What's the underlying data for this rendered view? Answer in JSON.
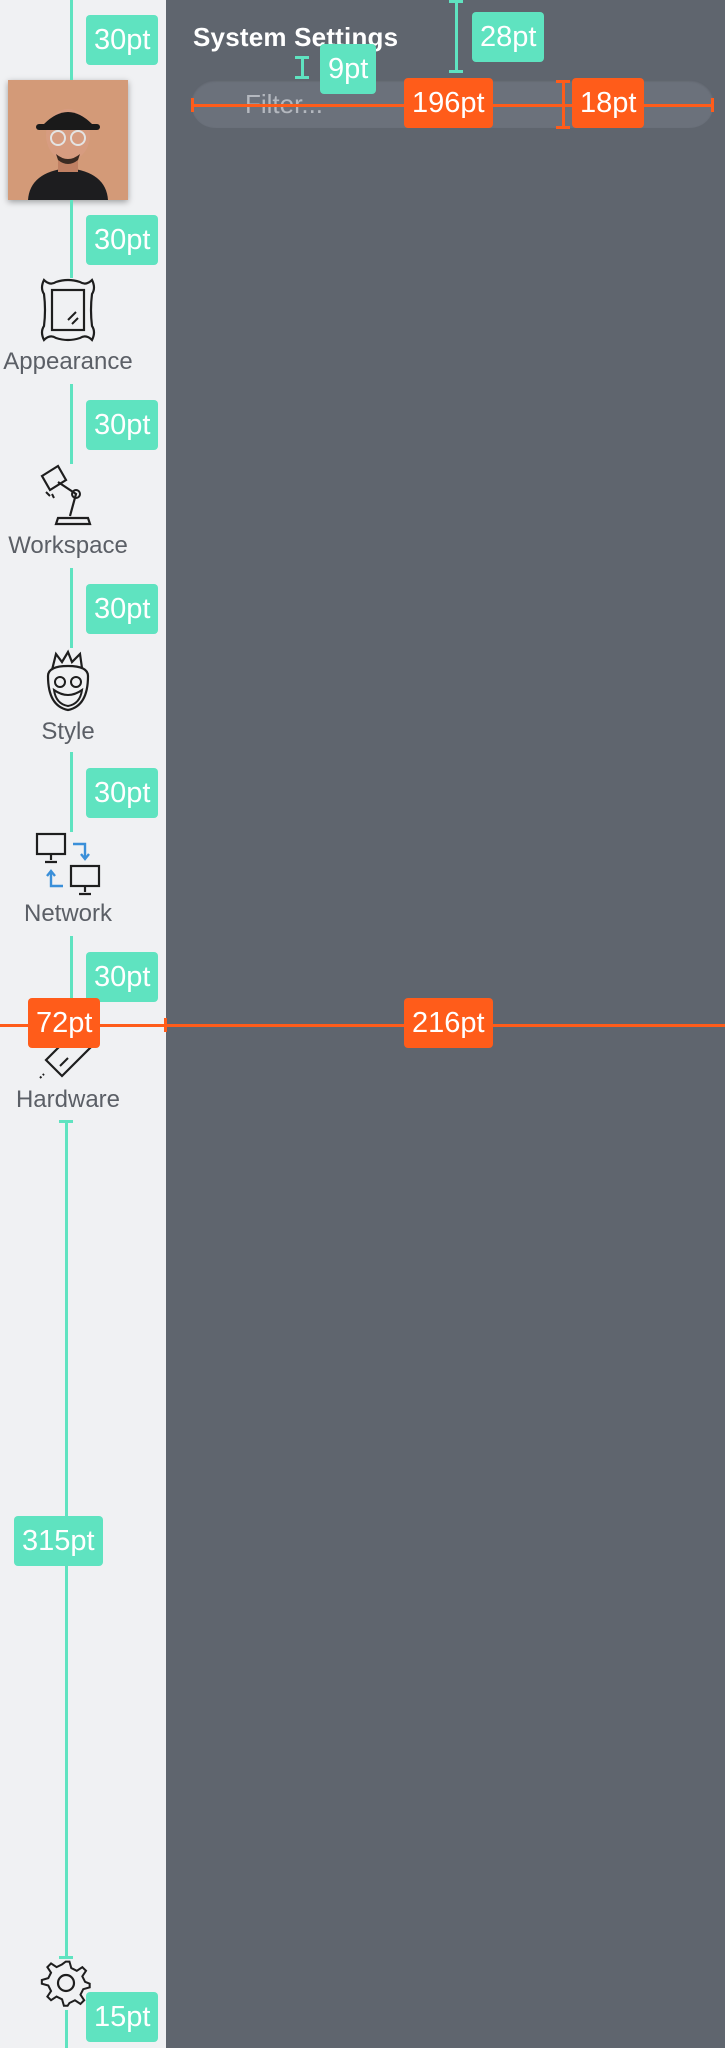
{
  "header": {
    "title": "System Settings"
  },
  "filter": {
    "placeholder": "Filter..."
  },
  "sidebar": {
    "items": [
      {
        "label": "Appearance",
        "icon": "picture-frame-icon"
      },
      {
        "label": "Workspace",
        "icon": "desk-lamp-icon"
      },
      {
        "label": "Style",
        "icon": "bearded-face-icon"
      },
      {
        "label": "Network",
        "icon": "network-computers-icon"
      },
      {
        "label": "Hardware",
        "icon": "tag-icon"
      }
    ],
    "footer_icon": "gear-icon"
  },
  "measurements": {
    "gap_top": "30pt",
    "gap_avatar": "30pt",
    "gap_appearance": "30pt",
    "gap_workspace": "30pt",
    "gap_style": "30pt",
    "gap_network": "30pt",
    "sidebar_width": "72pt",
    "content_width": "216pt",
    "title_offset": "28pt",
    "title_filter_gap": "9pt",
    "filter_width": "196pt",
    "filter_padding": "18pt",
    "footer_gap": "315pt",
    "bottom_gap": "15pt"
  },
  "colors": {
    "sidebar_bg": "#f0f1f3",
    "content_bg": "#5f656e",
    "measure_green": "#5fe3c0",
    "measure_orange": "#ff5c1a",
    "network_accent": "#3a8fd9"
  }
}
